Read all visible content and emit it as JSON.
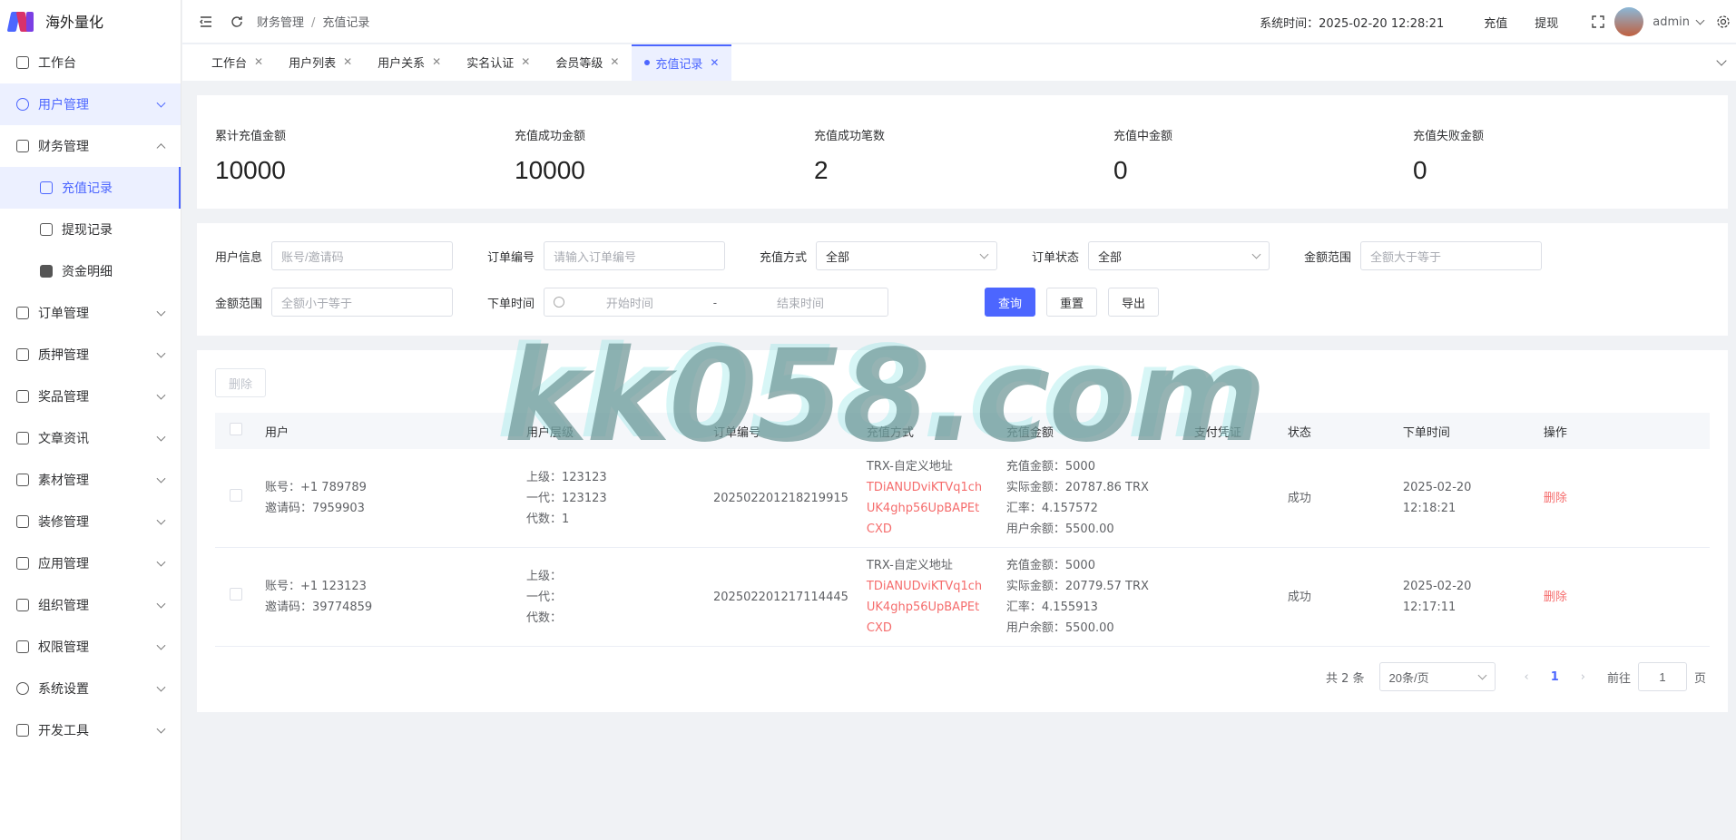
{
  "app": {
    "name": "海外量化"
  },
  "sidebar": {
    "items": [
      {
        "label": "工作台",
        "icon": "monitor-icon"
      },
      {
        "label": "用户管理",
        "icon": "user-icon"
      },
      {
        "label": "财务管理",
        "icon": "chart-icon"
      },
      {
        "label": "订单管理",
        "icon": "order-icon"
      },
      {
        "label": "质押管理",
        "icon": "pledge-icon"
      },
      {
        "label": "奖品管理",
        "icon": "bag-icon"
      },
      {
        "label": "文章资讯",
        "icon": "article-icon"
      },
      {
        "label": "素材管理",
        "icon": "image-icon"
      },
      {
        "label": "装修管理",
        "icon": "decorate-icon"
      },
      {
        "label": "应用管理",
        "icon": "app-icon"
      },
      {
        "label": "组织管理",
        "icon": "org-icon"
      },
      {
        "label": "权限管理",
        "icon": "lock-icon"
      },
      {
        "label": "系统设置",
        "icon": "gear-icon"
      },
      {
        "label": "开发工具",
        "icon": "pen-icon"
      }
    ],
    "finance_sub": [
      {
        "label": "充值记录",
        "icon": "folder-icon"
      },
      {
        "label": "提现记录",
        "icon": "folder-icon"
      },
      {
        "label": "资金明细",
        "icon": "wallet-icon"
      }
    ]
  },
  "header": {
    "breadcrumb": [
      "财务管理",
      "充值记录"
    ],
    "system_time": "系统时间：2025-02-20 12:28:21",
    "recharge": "充值",
    "withdraw": "提现",
    "username": "admin"
  },
  "tabs": [
    "工作台",
    "用户列表",
    "用户关系",
    "实名认证",
    "会员等级",
    "充值记录"
  ],
  "stats": [
    {
      "label": "累计充值金额",
      "value": "10000"
    },
    {
      "label": "充值成功金额",
      "value": "10000"
    },
    {
      "label": "充值成功笔数",
      "value": "2"
    },
    {
      "label": "充值中金额",
      "value": "0"
    },
    {
      "label": "充值失败金额",
      "value": "0"
    }
  ],
  "filters": {
    "user_info": {
      "label": "用户信息",
      "placeholder": "账号/邀请码"
    },
    "order_no": {
      "label": "订单编号",
      "placeholder": "请输入订单编号"
    },
    "pay_method": {
      "label": "充值方式",
      "value": "全部"
    },
    "order_status": {
      "label": "订单状态",
      "value": "全部"
    },
    "amount_min": {
      "label": "金额范围",
      "placeholder": "全额大于等于"
    },
    "amount_max": {
      "label": "金额范围",
      "placeholder": "全额小于等于"
    },
    "order_time": {
      "label": "下单时间",
      "start": "开始时间",
      "sep": "-",
      "end": "结束时间"
    },
    "query": "查询",
    "reset": "重置",
    "export": "导出"
  },
  "table": {
    "delete_btn": "删除",
    "columns": [
      "用户",
      "用户层级",
      "订单编号",
      "充值方式",
      "充值金额",
      "支付凭证",
      "状态",
      "下单时间",
      "操作"
    ],
    "rows": [
      {
        "account": "账号：+1 789789",
        "invite": "邀请码：7959903",
        "level1": "上级：123123",
        "level2": "一代：123123",
        "level3": "代数：",
        "level3_num": "1",
        "order_no": "202502201218219915",
        "method": "TRX-自定义地址",
        "address": [
          "TDiANUDviKTVq1ch",
          "UK4ghp56UpBAPEt",
          "CXD"
        ],
        "amt1": "充值金额：5000",
        "amt2": "实际金额：20787.86 TRX",
        "amt3": "汇率：4.157572",
        "amt4": "用户余额：5500.00",
        "status": "成功",
        "time": "2025-02-20 12:18:21",
        "action": "删除"
      },
      {
        "account": "账号：+1 123123",
        "invite": "邀请码：39774859",
        "level1": "上级：",
        "level2": "一代：",
        "level3": "代数：",
        "level3_num": "",
        "order_no": "202502201217114445",
        "method": "TRX-自定义地址",
        "address": [
          "TDiANUDviKTVq1ch",
          "UK4ghp56UpBAPEt",
          "CXD"
        ],
        "amt1": "充值金额：5000",
        "amt2": "实际金额：20779.57 TRX",
        "amt3": "汇率：4.155913",
        "amt4": "用户余额：5500.00",
        "status": "成功",
        "time": "2025-02-20 12:17:11",
        "action": "删除"
      }
    ]
  },
  "pagination": {
    "total": "共 2 条",
    "page_size": "20条/页",
    "current": "1",
    "goto": "前往",
    "goto_value": "1",
    "page_unit": "页"
  },
  "watermark": "kk058.com",
  "colors": {
    "primary": "#4c66ff",
    "danger": "#f56c6c"
  }
}
